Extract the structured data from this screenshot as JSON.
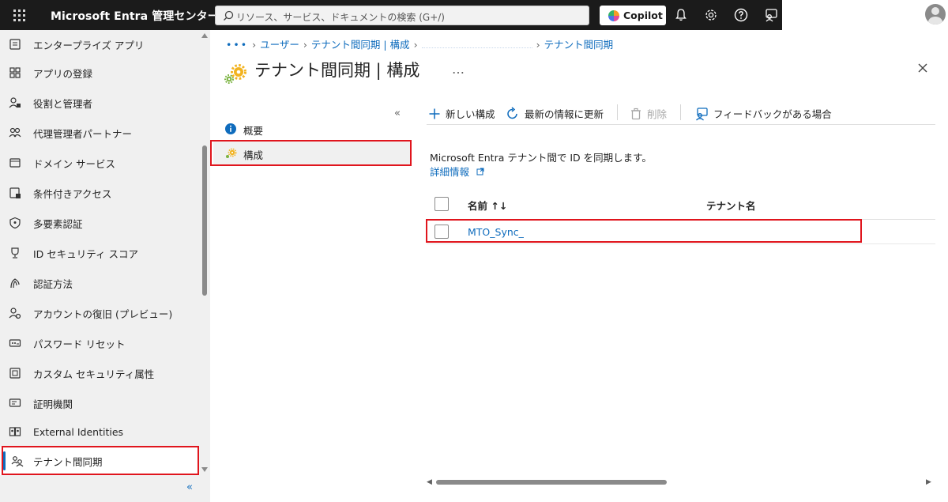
{
  "topbar": {
    "brand": "Microsoft Entra 管理センター",
    "search_placeholder": "リソース、サービス、ドキュメントの検索 (G+/)",
    "copilot_label": "Copilot",
    "icons": [
      "waffle-icon",
      "bell-icon",
      "gear-icon",
      "help-icon",
      "feedback-icon",
      "avatar"
    ]
  },
  "sidebar": {
    "items": [
      {
        "label": "エンタープライズ アプリ",
        "icon": "enterprise-apps-icon"
      },
      {
        "label": "アプリの登録",
        "icon": "app-registrations-icon"
      },
      {
        "label": "役割と管理者",
        "icon": "roles-icon"
      },
      {
        "label": "代理管理者パートナー",
        "icon": "delegated-admin-icon"
      },
      {
        "label": "ドメイン サービス",
        "icon": "domain-services-icon"
      },
      {
        "label": "条件付きアクセス",
        "icon": "conditional-access-icon"
      },
      {
        "label": "多要素認証",
        "icon": "mfa-icon"
      },
      {
        "label": "ID セキュリティ スコア",
        "icon": "trophy-icon"
      },
      {
        "label": "認証方法",
        "icon": "auth-methods-icon"
      },
      {
        "label": "アカウントの復旧 (プレビュー)",
        "icon": "account-recovery-icon"
      },
      {
        "label": "パスワード リセット",
        "icon": "password-reset-icon"
      },
      {
        "label": "カスタム セキュリティ属性",
        "icon": "custom-attributes-icon"
      },
      {
        "label": "証明機関",
        "icon": "certificate-icon"
      },
      {
        "label": "External Identities",
        "icon": "external-identities-icon"
      },
      {
        "label": "テナント間同期",
        "icon": "cross-tenant-sync-icon"
      }
    ],
    "selected_index": 14,
    "collapse_glyph": "«"
  },
  "breadcrumb": {
    "items": [
      "•••",
      "ユーザー",
      "テナント間同期 | 構成",
      "",
      "テナント間同期"
    ]
  },
  "page": {
    "title": "テナント間同期 | 構成",
    "more": "…"
  },
  "resource_nav": {
    "collapse_glyph": "«",
    "items": [
      {
        "label": "概要",
        "icon": "info-icon"
      },
      {
        "label": "構成",
        "icon": "configuration-gear-icon"
      }
    ],
    "selected_index": 1
  },
  "commands": {
    "new": "新しい構成",
    "refresh": "最新の情報に更新",
    "delete": "削除",
    "feedback": "フィードバックがある場合"
  },
  "content": {
    "description": "Microsoft Entra テナント間で ID を同期します。",
    "learn_more": "詳細情報"
  },
  "table": {
    "columns": [
      "名前 ↑↓",
      "テナント名"
    ],
    "rows": [
      {
        "name": "MTO_Sync_",
        "tenant": ""
      }
    ]
  },
  "colors": {
    "accent": "#0f6cbd",
    "highlight": "#e0151d",
    "topbar": "#1b1b1b"
  }
}
